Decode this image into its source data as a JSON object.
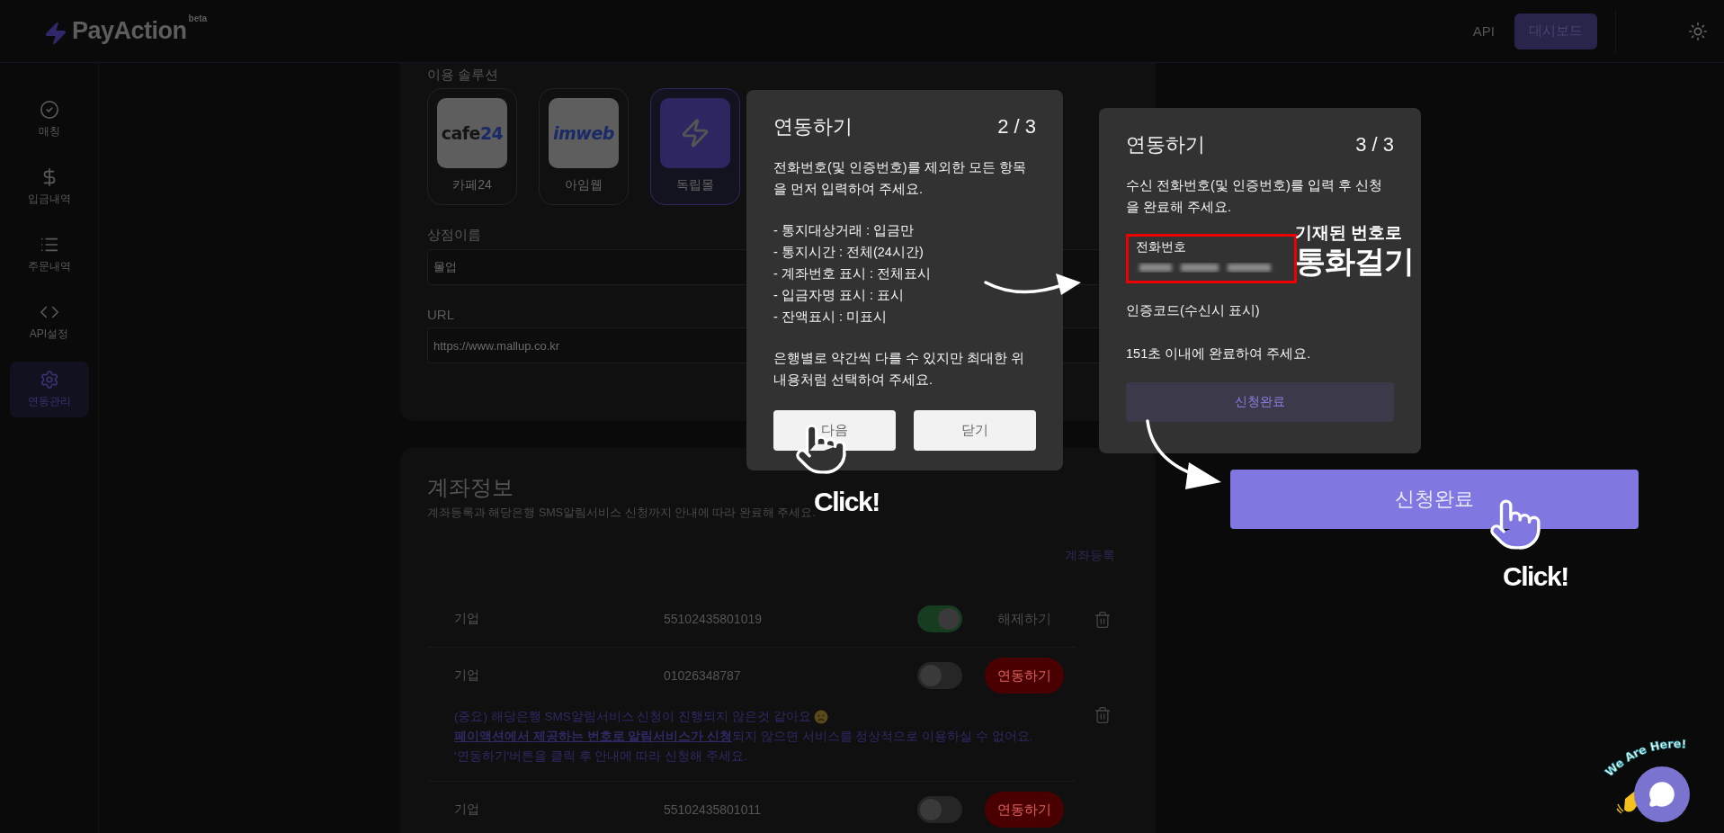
{
  "header": {
    "logo": "PayAction",
    "logo_badge": "beta",
    "nav": [
      {
        "label": "API",
        "kind": "link"
      },
      {
        "label": "대시보드",
        "kind": "button"
      }
    ]
  },
  "sidebar": {
    "items": [
      {
        "label": "매칭",
        "kind": "check",
        "selected": false
      },
      {
        "label": "입금내역",
        "kind": "dollar",
        "selected": false
      },
      {
        "label": "주문내역",
        "kind": "list",
        "selected": false
      },
      {
        "label": "API설정",
        "kind": "code",
        "selected": false
      },
      {
        "label": "연동관리",
        "kind": "gear",
        "selected": true
      }
    ]
  },
  "integration": {
    "solutions_label": "이용 솔루션",
    "solutions": [
      {
        "kind": "cafe24",
        "logo": "cafe",
        "logo_accent": "24",
        "label": "카페24",
        "selected": false
      },
      {
        "kind": "imweb",
        "logo": "imweb",
        "label": "아임웹",
        "selected": false
      },
      {
        "kind": "bolt",
        "label": "독립몰",
        "selected": true
      }
    ],
    "fields": [
      {
        "label": "상점이름",
        "value": "몰업"
      },
      {
        "label": "URL",
        "value": "https://www.mallup.co.kr"
      }
    ]
  },
  "accounts": {
    "title": "계좌정보",
    "subtitle": "계좌등록과 해당은행 SMS알림서비스 신청까지 안내에 따라 완료해 주세요.",
    "register_link": "계좌등록",
    "rows": [
      {
        "bank": "기업",
        "number": "55102435801019",
        "on": true,
        "action": "해제하기",
        "deletable": true
      },
      {
        "bank": "기업",
        "number": "01026348787",
        "on": false,
        "action": "연동하기",
        "deletable": true,
        "warning": [
          "(중요) 해당은행 SMS알림서비스 신청이 진행되지 않은것 같아요",
          "**페이액션에서 제공하는 번호로 알림서비스가 신청**되지 않으면 서비스를 정상적으로 이용하실 수 없어요.",
          "'연동하기'버튼을 클릭 후 안내에 따라 신청해 주세요."
        ]
      },
      {
        "bank": "기업",
        "number": "55102435801011",
        "on": false,
        "action": "연동하기",
        "deletable": false
      }
    ]
  },
  "step2_dialog": {
    "title": "연동하기",
    "step": "2 / 3",
    "intro": "전화번호(및 인증번호)를 제외한 모든 항목을 먼저 입력하여 주세요.",
    "items": [
      "- 통지대상거래 : 입금만",
      "- 통지시간 : 전체(24시간)",
      "- 계좌번호 표시 : 전체표시",
      "- 입금자명 표시 : 표시",
      "- 잔액표시 : 미표시"
    ],
    "note": "은행별로 약간씩 다를 수 있지만 최대한 위 내용처럼 선택하여 주세요.",
    "buttons": [
      "다음",
      "닫기"
    ]
  },
  "step3_dialog": {
    "title": "연동하기",
    "step": "3 / 3",
    "intro": "수신 전화번호(및 인증번호)를 입력 후 신청을 완료해 주세요.",
    "phone_label": "전화번호",
    "code_label": "인증코드(수신시 표시)",
    "timer": "151초 이내에 완료하여 주세요.",
    "button": "신청완료"
  },
  "annotations": {
    "call_hint": "기재된 번호로",
    "call_hint_big": "통화걸기",
    "big_button": "신청완료",
    "clicks": [
      "Click!",
      "Click!"
    ]
  },
  "chat": {
    "badge": "We Are Here!"
  }
}
